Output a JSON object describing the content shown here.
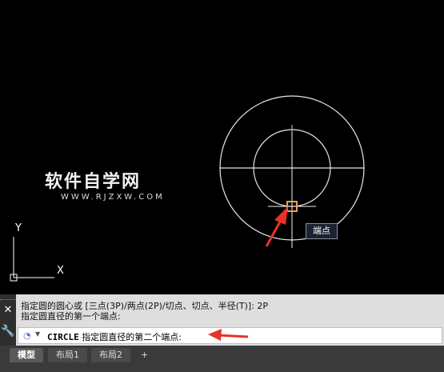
{
  "watermark": {
    "title": "软件自学网",
    "url": "WWW.RJZXW.COM"
  },
  "viewport": {
    "tooltip": "端点",
    "ucs": {
      "x_label": "X",
      "y_label": "Y"
    }
  },
  "command": {
    "close_icon": "✕",
    "wrench_icon": "🔧",
    "history": [
      "指定圆的圆心或 [三点(3P)/两点(2P)/切点、切点、半径(T)]: 2P",
      "指定圆直径的第一个端点:"
    ],
    "prompt_keyword": "CIRCLE",
    "prompt_text": " 指定圆直径的第二个端点:"
  },
  "layout_tabs": {
    "tabs": [
      "模型",
      "布局1",
      "布局2"
    ],
    "add_label": "+"
  },
  "colors": {
    "canvas_bg": "#000000",
    "circle_stroke": "#ffffff",
    "osnap_marker": "#f0a050",
    "arrow": "#e8312a"
  }
}
